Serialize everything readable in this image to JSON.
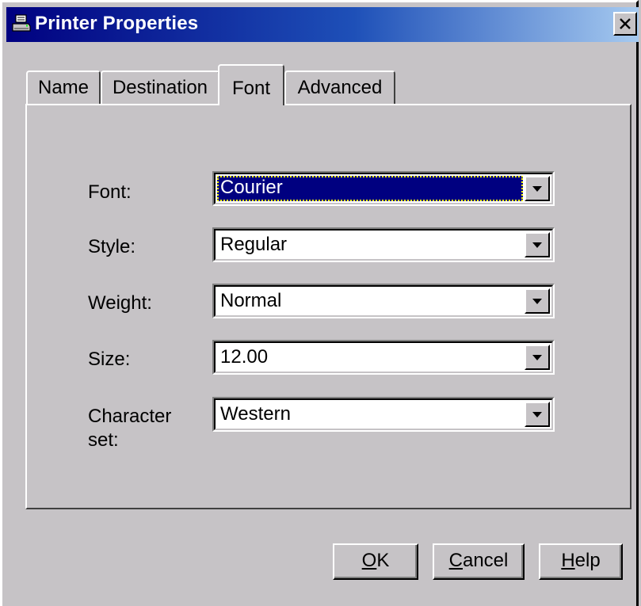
{
  "window": {
    "title": "Printer Properties",
    "icon": "printer-icon",
    "close_label": "×"
  },
  "tabs": [
    {
      "label": "Name",
      "active": false
    },
    {
      "label": "Destination",
      "active": false
    },
    {
      "label": "Font",
      "active": true
    },
    {
      "label": "Advanced",
      "active": false
    }
  ],
  "fields": {
    "font": {
      "label": "Font:",
      "value": "Courier"
    },
    "style": {
      "label": "Style:",
      "value": "Regular"
    },
    "weight": {
      "label": "Weight:",
      "value": "Normal"
    },
    "size": {
      "label": "Size:",
      "value": "12.00"
    },
    "charset": {
      "label": "Character set:",
      "value": "Western"
    }
  },
  "buttons": {
    "ok": {
      "mnemonic": "O",
      "rest": "K"
    },
    "cancel": {
      "mnemonic": "C",
      "rest": "ancel"
    },
    "help": {
      "mnemonic": "H",
      "rest": "elp"
    }
  },
  "colors": {
    "title_bar_start": "#000080",
    "title_bar_end": "#a6caf0",
    "selection": "#000080",
    "face": "#c6c3c6"
  }
}
